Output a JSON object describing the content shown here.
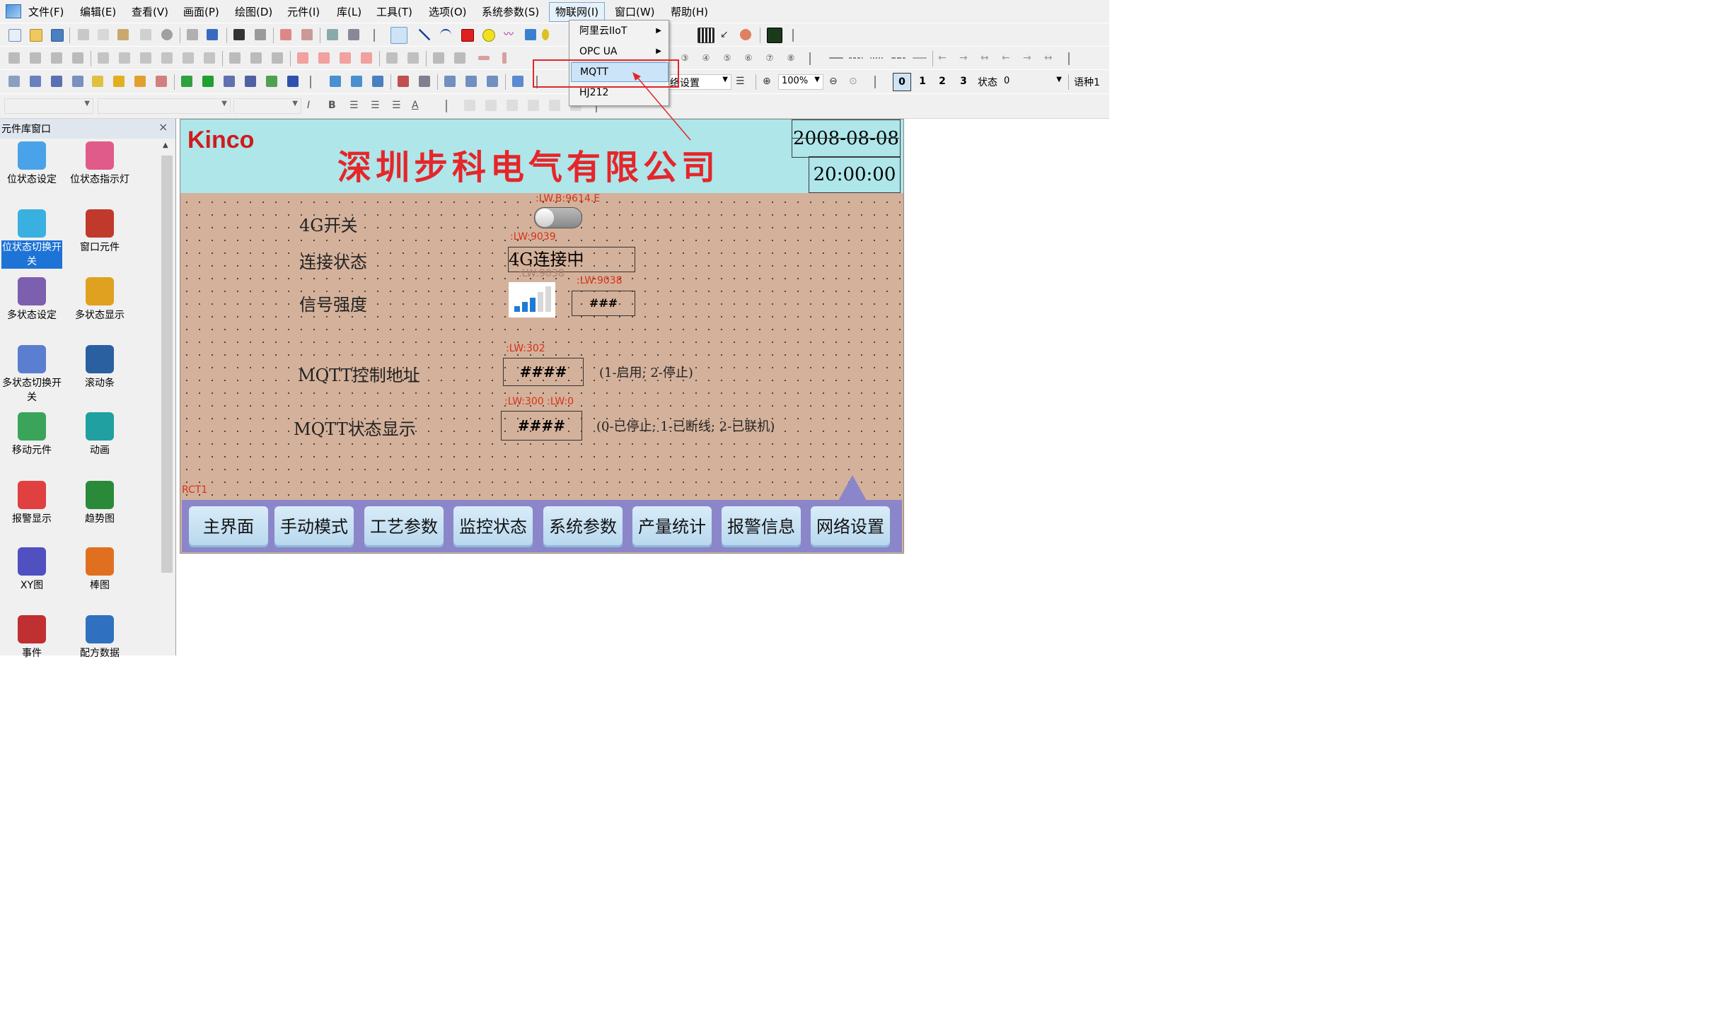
{
  "menubar": {
    "items": [
      "文件(F)",
      "编辑(E)",
      "查看(V)",
      "画面(P)",
      "绘图(D)",
      "元件(I)",
      "库(L)",
      "工具(T)",
      "选项(O)",
      "系统参数(S)",
      "物联网(I)",
      "窗口(W)",
      "帮助(H)"
    ]
  },
  "dropdown": {
    "items": [
      {
        "label": "阿里云IIoT",
        "submenu": true
      },
      {
        "label": "OPC UA",
        "submenu": true
      },
      {
        "label": "MQTT",
        "submenu": false,
        "selected": true
      },
      {
        "label": "HJ212",
        "submenu": false
      }
    ]
  },
  "toolbar": {
    "screen_combo": "络设置",
    "zoom": "100%",
    "state_tabs": [
      "0",
      "1",
      "2",
      "3"
    ],
    "state_label": "状态",
    "state_value": "0",
    "lang_label": "语种1"
  },
  "library": {
    "title": "元件库窗口",
    "items": [
      {
        "label": "位状态设定",
        "icon": "bit-state-set-icon",
        "color": "#4aa3e8"
      },
      {
        "label": "位状态指示灯",
        "icon": "bit-indicator-lamp-icon",
        "color": "#e05a8a"
      },
      {
        "label": "位状态切换开关",
        "icon": "bit-toggle-switch-icon",
        "color": "#3ab0e0",
        "selected": true
      },
      {
        "label": "窗口元件",
        "icon": "window-element-icon",
        "color": "#c0392b"
      },
      {
        "label": "多状态设定",
        "icon": "multi-state-set-icon",
        "color": "#7d5fb0"
      },
      {
        "label": "多状态显示",
        "icon": "multi-state-display-icon",
        "color": "#e0a020"
      },
      {
        "label": "多状态切换开关",
        "icon": "multi-state-switch-icon",
        "color": "#5a7fd0"
      },
      {
        "label": "滚动条",
        "icon": "scrollbar-icon",
        "color": "#2a5fa0"
      },
      {
        "label": "移动元件",
        "icon": "move-element-icon",
        "color": "#3aa55a"
      },
      {
        "label": "动画",
        "icon": "animation-icon",
        "color": "#20a0a0"
      },
      {
        "label": "报警显示",
        "icon": "alarm-display-icon",
        "color": "#e04040"
      },
      {
        "label": "趋势图",
        "icon": "trend-chart-icon",
        "color": "#2a8a3a"
      },
      {
        "label": "XY图",
        "icon": "xy-chart-icon",
        "color": "#5050c0"
      },
      {
        "label": "棒图",
        "icon": "bar-chart-icon",
        "color": "#e07020"
      },
      {
        "label": "事件",
        "icon": "event-icon",
        "color": "#c03030"
      },
      {
        "label": "配方数据",
        "icon": "recipe-data-icon",
        "color": "#3070c0"
      }
    ]
  },
  "screen": {
    "brand": "Kinco",
    "company": "深圳步科电气有限公司",
    "date": "2008-08-08",
    "time": "20:00:00",
    "rows": {
      "switch_label": "4G开关",
      "switch_addr": ":LW.B:9614.E",
      "connect_label": "连接状态",
      "connect_addr": ":LW:9039",
      "connect_value": "4G连接中",
      "signal_label": "信号强度",
      "signal_icon_addr": ":LW:9038",
      "signal_addr": ":LW:9038",
      "signal_value": "###",
      "mqtt_ctrl_label": "MQTT控制地址",
      "mqtt_ctrl_addr": ":LW:302",
      "mqtt_ctrl_value": "####",
      "mqtt_ctrl_hint": "(1-启用; 2-停止)",
      "mqtt_state_label": "MQTT状态显示",
      "mqtt_state_addr": ":LW:300 :LW:0",
      "mqtt_state_value": "####",
      "mqtt_state_hint": "(0-已停止; 1-已断线; 2-已联机)"
    },
    "rect_label": "RCT1",
    "nav": [
      "主界面",
      "手动模式",
      "工艺参数",
      "监控状态",
      "系统参数",
      "产量统计",
      "报警信息",
      "网络设置"
    ]
  },
  "colors": {
    "highlight": "#e2262b",
    "header_band": "#aee6ea",
    "screen_bg": "#d4b19b",
    "company_text": "#e5262a",
    "brand_text": "#d01c1c",
    "address_text": "#d4331a",
    "nav_bar": "#8b86c9"
  }
}
